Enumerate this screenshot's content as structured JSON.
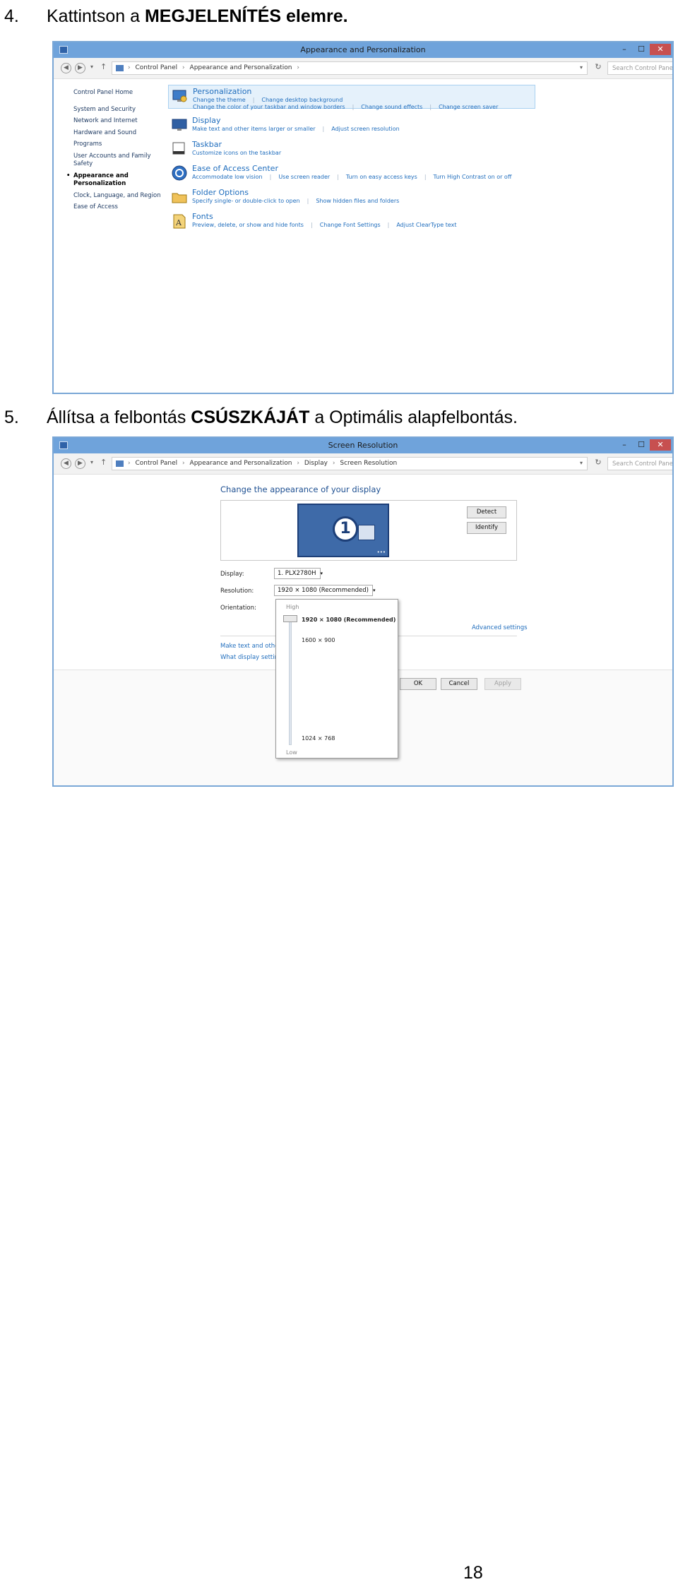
{
  "steps": [
    {
      "num": "4.",
      "pre": "Kattintson a ",
      "bold": "MEGJELENÍTÉS elemre.",
      "post": ""
    },
    {
      "num": "5.",
      "pre": "Állítsa a felbontás ",
      "bold": "CSÚSZKÁJÁT",
      "post": " a Optimális alapfelbontás."
    }
  ],
  "window1": {
    "title": "Appearance and Personalization",
    "controls": [
      "–",
      "☐",
      "✕"
    ],
    "breadcrumb": [
      "Control Panel",
      "Appearance and Personalization"
    ],
    "search_placeholder": "Search Control Panel",
    "nav": [
      "Control Panel Home",
      "System and Security",
      "Network and Internet",
      "Hardware and Sound",
      "Programs",
      "User Accounts and Family Safety",
      "Appearance and Personalization",
      "Clock, Language, and Region",
      "Ease of Access"
    ],
    "selected_nav_index": 6,
    "categories": [
      {
        "title": "Personalization",
        "icon": "personalization-icon",
        "links": [
          "Change the theme",
          "Change desktop background",
          "Change the color of your taskbar and window borders",
          "Change sound effects",
          "Change screen saver"
        ]
      },
      {
        "title": "Display",
        "icon": "display-icon",
        "links": [
          "Make text and other items larger or smaller",
          "Adjust screen resolution"
        ]
      },
      {
        "title": "Taskbar",
        "icon": "taskbar-icon",
        "links": [
          "Customize icons on the taskbar"
        ]
      },
      {
        "title": "Ease of Access Center",
        "icon": "ease-of-access-icon",
        "links": [
          "Accommodate low vision",
          "Use screen reader",
          "Turn on easy access keys",
          "Turn High Contrast on or off"
        ]
      },
      {
        "title": "Folder Options",
        "icon": "folder-options-icon",
        "links": [
          "Specify single- or double-click to open",
          "Show hidden files and folders"
        ]
      },
      {
        "title": "Fonts",
        "icon": "fonts-icon",
        "links": [
          "Preview, delete, or show and hide fonts",
          "Change Font Settings",
          "Adjust ClearType text"
        ]
      }
    ]
  },
  "window2": {
    "title": "Screen Resolution",
    "controls": [
      "–",
      "☐",
      "✕"
    ],
    "breadcrumb": [
      "Control Panel",
      "Appearance and Personalization",
      "Display",
      "Screen Resolution"
    ],
    "search_placeholder": "Search Control Panel",
    "heading": "Change the appearance of your display",
    "monitor_number": "1",
    "detect_label": "Detect",
    "identify_label": "Identify",
    "display_label": "Display:",
    "display_value": "1. PLX2780H",
    "resolution_label": "Resolution:",
    "resolution_value": "1920 × 1080 (Recommended)",
    "orientation_label": "Orientation:",
    "slider": {
      "high": "High",
      "low": "Low",
      "position": 1.0
    },
    "options": [
      "1920 × 1080 (Recommended)",
      "1600 × 900",
      "1024 × 768"
    ],
    "advanced": "Advanced settings",
    "link1": "Make text and other",
    "link2": "What display setting",
    "ok": "OK",
    "cancel": "Cancel",
    "apply": "Apply"
  },
  "page_number": "18"
}
